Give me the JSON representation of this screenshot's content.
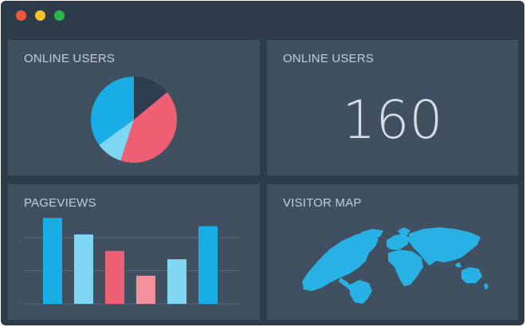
{
  "window": {
    "controls": [
      {
        "name": "close",
        "color": "#f0583c"
      },
      {
        "name": "minimize",
        "color": "#f6c22a"
      },
      {
        "name": "maximize",
        "color": "#2bb94b"
      }
    ]
  },
  "panels": {
    "online_users_chart": {
      "title": "ONLINE USERS"
    },
    "online_users_count": {
      "title": "ONLINE USERS",
      "value": "160"
    },
    "pageviews": {
      "title": "PAGEVIEWS"
    },
    "visitor_map": {
      "title": "VISITOR MAP",
      "map_color": "#27b1e4"
    }
  },
  "colors": {
    "background": "#2d3b4b",
    "panel": "#405060",
    "blue": "#18ade4",
    "light_blue": "#7fd6f2",
    "dark": "#2e3e50",
    "pink": "#ef5f73",
    "light_pink": "#f3929d",
    "grid": "#56687a"
  },
  "chart_data": [
    {
      "type": "pie",
      "slices": [
        {
          "value": 14,
          "color": "#2e3e50"
        },
        {
          "value": 41,
          "color": "#ef5f73"
        },
        {
          "value": 10,
          "color": "#7fd6f2"
        },
        {
          "value": 35,
          "color": "#18ade4"
        }
      ]
    },
    {
      "type": "bar",
      "values": [
        104,
        84,
        64,
        34,
        54,
        94
      ],
      "colors": [
        "#18ade4",
        "#7fd6f2",
        "#ef5f73",
        "#f3929d",
        "#7fd6f2",
        "#18ade4"
      ],
      "ylim": [
        0,
        110
      ],
      "grid": true
    }
  ]
}
